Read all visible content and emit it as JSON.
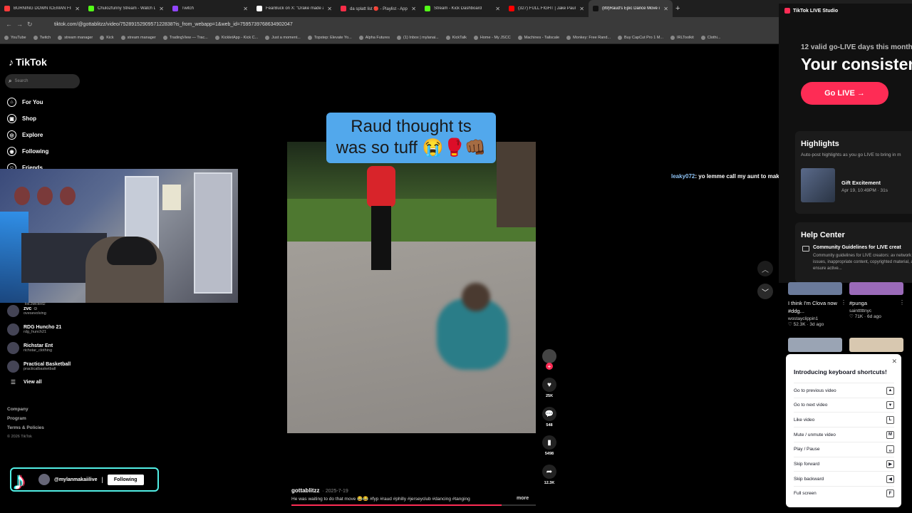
{
  "browser": {
    "tabs": [
      {
        "title": "BURNING DOWN ICEMAN FINA",
        "color": "#ff3b3b"
      },
      {
        "title": "Chulo2funny Stream - Watch L",
        "color": "#53fc18"
      },
      {
        "title": "Twitch",
        "color": "#9146ff"
      },
      {
        "title": "FearBuck on X: \"Drake made a",
        "color": "#ffffff"
      },
      {
        "title": "da splatt list 🔴 - Playlist - App",
        "color": "#fa2d48"
      },
      {
        "title": "Stream - Kick Dashboard",
        "color": "#53fc18"
      },
      {
        "title": "(327) FULL FIGHT | Jake Paul vs",
        "color": "#ff0000"
      },
      {
        "title": "(89)Raud's Epic Dance Move in",
        "color": "#111111"
      }
    ],
    "url": "tiktok.com/@gottablitzz/video/7528915290957122838?is_from_webapp=1&web_id=7595739768634902047",
    "bookmarks": [
      "YouTube",
      "Twitch",
      "stream manager",
      "Kick",
      "stream manager",
      "TradingView — Trac...",
      "KickletApp - Kick C...",
      "Just a moment...",
      "Topstep: Elevate Yo...",
      "Alpha Futures",
      "(1) Inbox | mylanai...",
      "KickTalk",
      "Home - My JSCC",
      "Machines - Tailscale",
      "Monkey: Free Rand...",
      "Buy CapCut Pro 1 M...",
      "IRLToolkit",
      "Clothi..."
    ]
  },
  "sidebar": {
    "logo": "TikTok",
    "search_placeholder": "Search",
    "nav": [
      "For You",
      "Shop",
      "Explore",
      "Following",
      "Friends"
    ],
    "nav_icons": [
      "home-icon",
      "shop-icon",
      "explore-icon",
      "following-icon",
      "friends-icon"
    ],
    "following": [
      {
        "name": "zvc ☺",
        "handle": "ovesevolving"
      },
      {
        "name": "RDG Huncho 21",
        "handle": "rdg_hunch21"
      },
      {
        "name": "Richstar Ent",
        "handle": "richstar_clothing"
      },
      {
        "name": "Practical Basketball",
        "handle": "practicalbasketball"
      }
    ],
    "partial_handle": "los.2wicked2",
    "view_all": "View all",
    "links": [
      "Company",
      "Program",
      "Terms & Policies"
    ],
    "copyright": "© 2026 TikTok"
  },
  "overlay": {
    "handle": "@mylanmakaiilive",
    "separator": "|",
    "following_btn": "Following"
  },
  "video": {
    "caption_line1": "Raud thought ts",
    "caption_line2": "was so tuff 😭🥊👊🏾",
    "author": "gottablitzz",
    "date": "· 2025-7-19",
    "description": "He was waiting to do that move 😂😂 #fyp #raud #philly #jerseyclub #dancing #tanging",
    "more": "more",
    "progress_fraction": 0.86,
    "likes": "25K",
    "comments": "548",
    "saves": "5498",
    "shares": "12.3K"
  },
  "chat": {
    "user": "leaky072",
    "message": ": yo lemme call my aunt to make sure she not dead bro im scared"
  },
  "studio": {
    "title": "TikTok LIVE Studio",
    "subtitle": "12 valid go-LIVE days this month",
    "headline": "Your consisten",
    "go_live": "Go LIVE →",
    "highlights_title": "Highlights",
    "highlights_sub": "Auto-post highlights as you go LIVE to bring in m",
    "highlight_name": "Gift Excitement",
    "highlight_meta": "Apr 19, 10:49PM · 31s",
    "help_title": "Help Center",
    "help_item": "Community Guidelines for LIVE creat",
    "help_desc": "Community guidelines for LIVE creators: av network issues, inappropriate content, copyrighted material, and ensure active..."
  },
  "recommended": [
    {
      "title": "I think I'm Clova now #ddg...",
      "author": "wostayclippin1",
      "stats": "♡ 52.3K · 3d ago"
    },
    {
      "title": "#punga",
      "author": "saintttttnyc",
      "stats": "♡ 71K · 6d ago"
    }
  ],
  "shortcuts": {
    "title": "Introducing keyboard shortcuts!",
    "items": [
      {
        "label": "Go to previous video",
        "key": "▲"
      },
      {
        "label": "Go to next video",
        "key": "▼"
      },
      {
        "label": "Like video",
        "key": "L"
      },
      {
        "label": "Mute / unmute video",
        "key": "M"
      },
      {
        "label": "Play / Pause",
        "key": "␣"
      },
      {
        "label": "Skip forward",
        "key": "▶"
      },
      {
        "label": "Skip backward",
        "key": "◀"
      },
      {
        "label": "Full screen",
        "key": "F"
      }
    ]
  }
}
